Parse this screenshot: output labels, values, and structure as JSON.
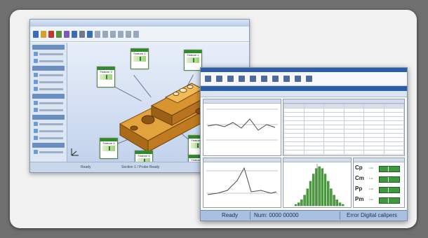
{
  "window_main": {
    "status_left": "Ready",
    "status_center": "Section 1 / Probe Ready"
  },
  "inspection_tags": [
    {
      "id": "tag1",
      "title": "Feature 1"
    },
    {
      "id": "tag2",
      "title": "Feature 2"
    },
    {
      "id": "tag3",
      "title": "Feature 3"
    },
    {
      "id": "tag4",
      "title": "Feature 4"
    },
    {
      "id": "tag5",
      "title": "Feature 5"
    },
    {
      "id": "tag6",
      "title": "Feature 6"
    },
    {
      "id": "tag7",
      "title": "Feature 7"
    }
  ],
  "window_spc": {
    "status_ready": "Ready",
    "status_num": "Num: 0000 00000",
    "status_right": "Error Digital calipers"
  },
  "capability_labels": [
    "Cp",
    "Cm",
    "Pp",
    "Pm"
  ],
  "capability_values": [
    "1.24",
    "1.31",
    "1.18",
    "1.22"
  ],
  "colors": {
    "accent": "#2a5fa8",
    "pass_green": "#3f9a3f",
    "part_orange": "#c8861f"
  }
}
